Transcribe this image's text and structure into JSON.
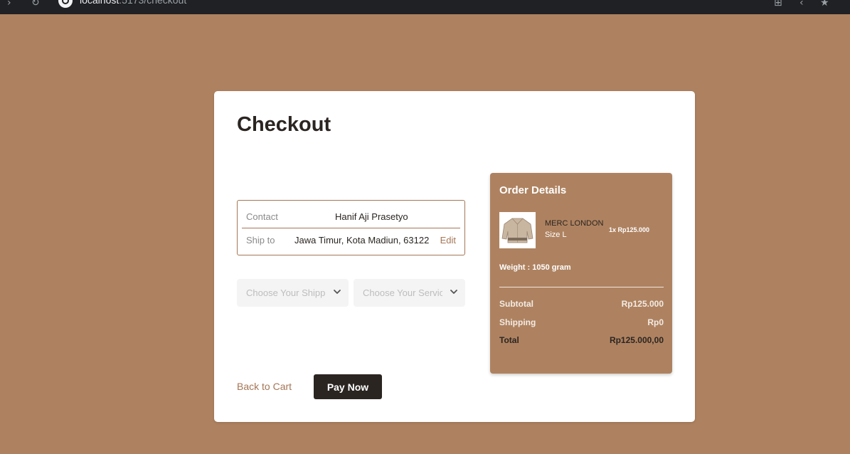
{
  "browser": {
    "url_host": "localhost",
    "url_path": ":5173/checkout"
  },
  "checkout": {
    "title": "Checkout",
    "contact": {
      "contact_label": "Contact",
      "contact_value": "Hanif Aji Prasetyo",
      "ship_label": "Ship to",
      "ship_value": "Jawa Timur, Kota Madiun, 63122",
      "edit_label": "Edit"
    },
    "shipping_select": {
      "placeholder": "Choose Your Shipping"
    },
    "service_select": {
      "placeholder": "Choose Your Service"
    },
    "back_label": "Back to Cart",
    "pay_label": "Pay Now"
  },
  "order": {
    "title": "Order Details",
    "item": {
      "name": "MERC LONDON",
      "size": "Size L",
      "qty_price": "1x Rp125.000"
    },
    "weight": "Weight : 1050 gram",
    "subtotal_label": "Subtotal",
    "subtotal_value": "Rp125.000",
    "shipping_label": "Shipping",
    "shipping_value": "Rp0",
    "total_label": "Total",
    "total_value": "Rp125.000,00"
  },
  "colors": {
    "page_bg": "#ae8260",
    "accent": "#a47656",
    "dark": "#2b2522",
    "panel_bg": "#ae8260"
  }
}
